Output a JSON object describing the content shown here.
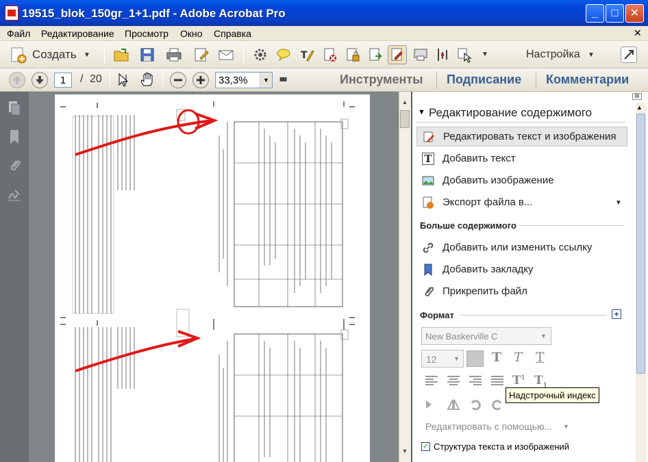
{
  "window": {
    "title": "19515_blok_150gr_1+1.pdf - Adobe Acrobat Pro",
    "minimize": "_",
    "maximize": "□",
    "close": "✕"
  },
  "menu": {
    "items": [
      "Файл",
      "Редактирование",
      "Просмотр",
      "Окно",
      "Справка"
    ],
    "close": "✕"
  },
  "toolbar": {
    "create_label": "Создать",
    "customize_label": "Настройка"
  },
  "nav": {
    "page_current": "1",
    "page_sep": "/",
    "page_total": "20",
    "zoom": "33,3%"
  },
  "tasks": {
    "tools": "Инструменты",
    "sign": "Подписание",
    "comments": "Комментарии"
  },
  "panel": {
    "header": "Редактирование содержимого",
    "items": [
      "Редактировать текст и изображения",
      "Добавить текст",
      "Добавить изображение",
      "Экспорт файла в..."
    ],
    "more_header": "Больше содержимого",
    "more_items": [
      "Добавить или изменить ссылку",
      "Добавить закладку",
      "Прикрепить файл"
    ],
    "format_header": "Формат",
    "font": "New Baskerville C",
    "font_size": "12",
    "tooltip": "Надстрочный индекс",
    "edit_with": "Редактировать с помощью...",
    "structure_label": "Структура текста и изображений"
  },
  "colors": {
    "titlebar": "#0a46d8",
    "accent": "#2f6cc8",
    "annotation": "#e01818"
  }
}
